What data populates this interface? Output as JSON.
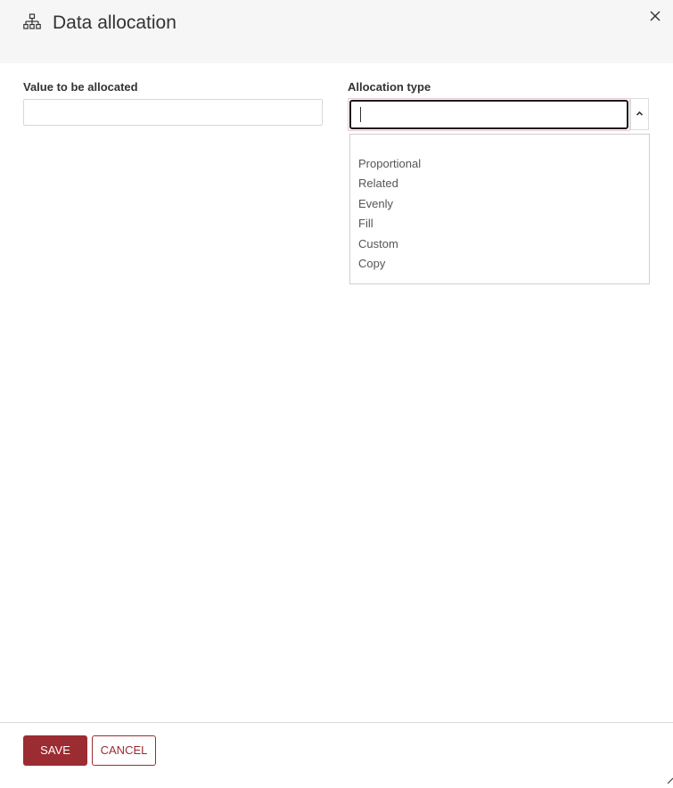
{
  "dialog": {
    "title": "Data allocation",
    "icon": "hierarchy-icon",
    "close_icon": "close-icon"
  },
  "fields": {
    "value_label": "Value to be allocated",
    "value_input": "",
    "type_label": "Allocation type",
    "type_input": ""
  },
  "allocation_options": [
    "Proportional",
    "Related",
    "Evenly",
    "Fill",
    "Custom",
    "Copy"
  ],
  "footer": {
    "save_label": "SAVE",
    "cancel_label": "CANCEL"
  },
  "colors": {
    "accent": "#9b2c32",
    "header_bg": "#f6f6f6"
  }
}
